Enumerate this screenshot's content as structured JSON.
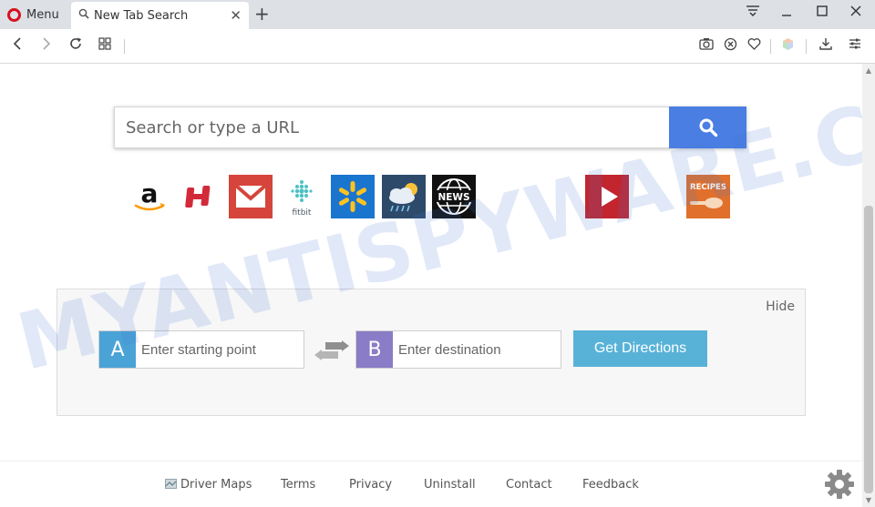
{
  "browser": {
    "menu_label": "Menu",
    "tab_title": "New Tab Search"
  },
  "search": {
    "placeholder": "Search or type a URL"
  },
  "tiles": [
    {
      "name": "amazon"
    },
    {
      "name": "hotels"
    },
    {
      "name": "gmail"
    },
    {
      "name": "fitbit",
      "label": "fitbit"
    },
    {
      "name": "walmart"
    },
    {
      "name": "weather"
    },
    {
      "name": "news",
      "label": "NEWS"
    },
    {
      "name": "youtube"
    },
    {
      "name": "recipes",
      "label": "RECIPES"
    }
  ],
  "directions": {
    "hide_label": "Hide",
    "start_badge": "A",
    "start_placeholder": "Enter starting point",
    "dest_badge": "B",
    "dest_placeholder": "Enter destination",
    "button_label": "Get Directions"
  },
  "footer": {
    "links": [
      "Driver Maps",
      "Terms",
      "Privacy",
      "Uninstall",
      "Contact",
      "Feedback"
    ]
  },
  "watermark": "MYANTISPYWARE.COM",
  "colors": {
    "search_button": "#4a7ee3",
    "badge_a": "#4aa3d6",
    "badge_b": "#8a7cc6",
    "directions_button": "#58b2d8"
  }
}
